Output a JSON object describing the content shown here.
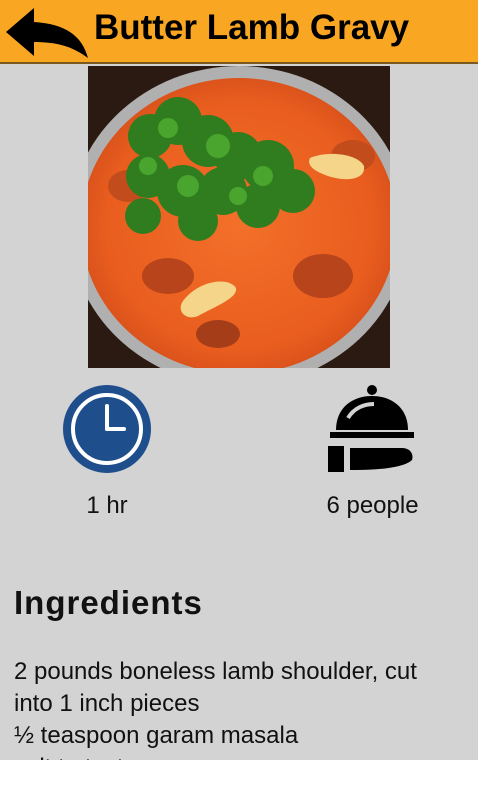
{
  "header": {
    "title": "Butter Lamb Gravy",
    "back_icon": "back-arrow-icon"
  },
  "recipe": {
    "image_alt": "butter lamb gravy dish photo",
    "time_icon": "clock-icon",
    "time_label": "1 hr",
    "servings_icon": "serving-cloche-icon",
    "servings_label": "6 people"
  },
  "ingredients": {
    "heading": "Ingredients",
    "items": [
      "2 pounds boneless lamb shoulder, cut",
      "into 1 inch pieces",
      "½ teaspoon garam masala",
      "salt to taste"
    ]
  },
  "colors": {
    "header_bg": "#f9a623",
    "content_bg": "#d3d3d3",
    "clock_blue": "#1f4e8c"
  }
}
